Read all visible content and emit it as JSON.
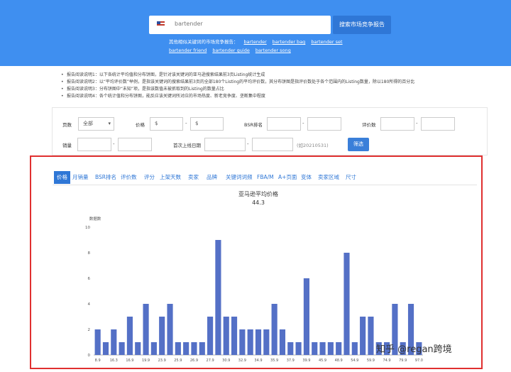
{
  "search": {
    "value": "bartender",
    "button": "搜索市场竞争报告"
  },
  "hints": {
    "lead": "其他相似关键词的市场竞争报告：",
    "links": [
      "bartender",
      "bartender bag",
      "bartender set",
      "bartender friend",
      "bartender guide",
      "bartender song"
    ]
  },
  "notes": [
    "报告阅读说明1：以下各统计平均值和分布饼图，是针对该关键词的亚马逊搜索结果前3页Listing统计生成",
    "报告阅读说明2：以“平均评价数”举例，是指该关键词的搜索结果前3页的全部180个Listing的平均评价数，其分布饼图是指评价数处于各个范围内的Listing数量，除以180所得的百分比",
    "报告阅读说明3：分布饼图中“未知”项，是指该数值未被抓取到的Listing的数量占比",
    "报告阅读说明4：各个统计值和分布饼图，能反应该关键词所对应的市场热度、新老竞争度、垄断集中程度"
  ],
  "filters": {
    "page_label": "页数",
    "page_value": "全部",
    "price_label": "价格",
    "price_min": "$",
    "price_max": "$",
    "bsr_label": "BSR排名",
    "review_label": "评价数",
    "sales_label": "销量",
    "date_label": "首次上线日期",
    "date_hint": "(如20210531)",
    "dash": "-",
    "filter_button": "筛选"
  },
  "tabs": [
    "价格",
    "月销量",
    "BSR排名",
    "评价数",
    "评分",
    "上架天数",
    "卖家",
    "品牌",
    "关键词词频",
    "FBA/M",
    "A+页面",
    "变体",
    "卖家区域",
    "尺寸"
  ],
  "watermark": "知乎 @regan跨境",
  "chart_data": {
    "type": "bar",
    "title": "亚马逊平均价格",
    "subtitle": "44.3",
    "ylabel": "数据数",
    "ylim": [
      0,
      10
    ],
    "yticks": [
      0,
      2,
      4,
      6,
      8,
      10
    ],
    "xticks": [
      "8.9",
      "16.3",
      "16.9",
      "19.9",
      "23.9",
      "25.9",
      "26.9",
      "27.9",
      "30.9",
      "32.9",
      "34.9",
      "35.9",
      "37.9",
      "39.9",
      "45.9",
      "48.9",
      "54.9",
      "59.9",
      "74.9",
      "79.9",
      "97.0"
    ],
    "values": [
      2,
      1,
      2,
      1,
      3,
      1,
      4,
      1,
      3,
      4,
      1,
      1,
      1,
      1,
      3,
      9,
      3,
      3,
      2,
      2,
      2,
      2,
      4,
      2,
      1,
      1,
      6,
      1,
      1,
      1,
      1,
      8,
      1,
      3,
      3,
      1,
      1,
      4,
      1,
      4,
      1
    ],
    "bar_color": "#5470c6"
  }
}
